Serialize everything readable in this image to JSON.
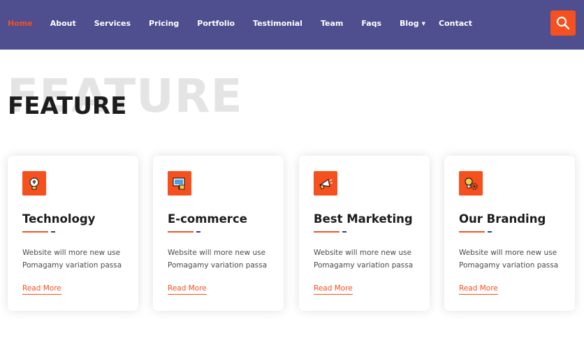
{
  "nav": {
    "items": [
      {
        "label": "Home",
        "active": true
      },
      {
        "label": "About"
      },
      {
        "label": "Services"
      },
      {
        "label": "Pricing"
      },
      {
        "label": "Portfolio"
      },
      {
        "label": "Testimonial"
      },
      {
        "label": "Team"
      },
      {
        "label": "Faqs"
      },
      {
        "label": "Blog",
        "has_dropdown": true
      },
      {
        "label": "Contact"
      }
    ],
    "search_icon": "search-icon"
  },
  "section": {
    "bg_title": "FEATURE",
    "title": "FEATURE"
  },
  "cards": [
    {
      "icon": "idea-bulb-icon",
      "title": "Technology",
      "text_line1": "Website will more new use",
      "text_line2": "Pomagamy variation passa",
      "link": "Read More"
    },
    {
      "icon": "ecommerce-screen-icon",
      "title": "E-commerce",
      "text_line1": "Website will more new use",
      "text_line2": "Pomagamy variation passa",
      "link": "Read More"
    },
    {
      "icon": "megaphone-icon",
      "title": "Best Marketing",
      "text_line1": "Website will more new use",
      "text_line2": "Pomagamy variation passa",
      "link": "Read More"
    },
    {
      "icon": "branding-gear-icon",
      "title": "Our Branding",
      "text_line1": "Website will more new use",
      "text_line2": "Pomagamy variation passa",
      "link": "Read More"
    }
  ],
  "colors": {
    "header_bg": "#4f4e8f",
    "accent": "#f5501e",
    "accent_dark": "#3d3c7a",
    "bg_title": "#e4e4e4"
  }
}
